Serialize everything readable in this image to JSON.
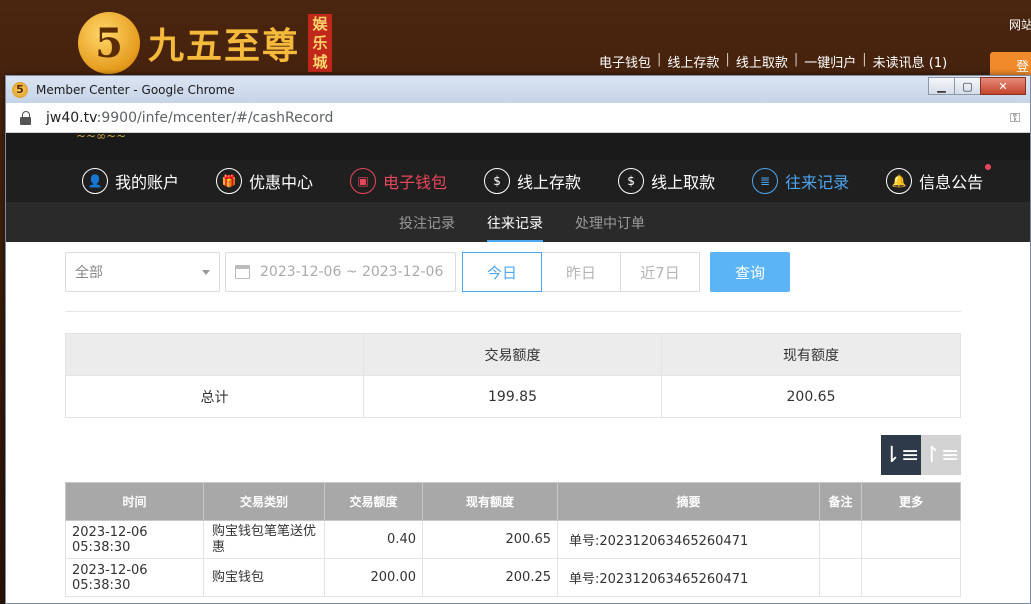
{
  "background_site": {
    "logo_number": "5",
    "logo_text": "九五至尊",
    "logo_tag": [
      "娱",
      "乐",
      "城"
    ],
    "top_links": [
      "电子钱包",
      "线上存款",
      "线上取款",
      "一键归户",
      "未读讯息 (1)"
    ],
    "corner_text": "网站",
    "corner_button": "登"
  },
  "window": {
    "title": "Member Center - Google Chrome",
    "controls": {
      "minimize": "▁",
      "maximize": "▢",
      "close": "✕"
    }
  },
  "address": {
    "host": "jw40.tv",
    "path": ":9900/infe/mcenter/#/cashRecord"
  },
  "nav": {
    "items": [
      {
        "label": "我的账户",
        "icon": "user-icon",
        "glyph": "👤"
      },
      {
        "label": "优惠中心",
        "icon": "gift-icon",
        "glyph": "🎁"
      },
      {
        "label": "电子钱包",
        "icon": "wallet-icon",
        "glyph": "▣"
      },
      {
        "label": "线上存款",
        "icon": "deposit-icon",
        "glyph": "$"
      },
      {
        "label": "线上取款",
        "icon": "withdraw-icon",
        "glyph": "$"
      },
      {
        "label": "往来记录",
        "icon": "record-icon",
        "glyph": "≣"
      },
      {
        "label": "信息公告",
        "icon": "bell-icon",
        "glyph": "🔔"
      }
    ],
    "colors": {
      "active_wallet": "#e8475b",
      "active_records": "#4da6f0"
    }
  },
  "subnav": {
    "items": [
      "投注记录",
      "往来记录",
      "处理中订单"
    ]
  },
  "filters": {
    "type_select": "全部",
    "date_range": "2023-12-06 ~ 2023-12-06",
    "range_buttons": [
      "今日",
      "昨日",
      "近7日"
    ],
    "query_button": "查询"
  },
  "summary": {
    "headers": [
      "",
      "交易额度",
      "现有额度"
    ],
    "row": {
      "label": "总计",
      "amount": "199.85",
      "balance": "200.65"
    }
  },
  "sort": {
    "desc_icon": "sort-desc-icon",
    "asc_icon": "sort-asc-icon"
  },
  "records": {
    "headers": [
      "时间",
      "交易类别",
      "交易额度",
      "现有额度",
      "摘要",
      "备注",
      "更多"
    ],
    "rows": [
      {
        "time": "2023-12-06 05:38:30",
        "type": "购宝钱包笔笔送优惠",
        "amount": "0.40",
        "balance": "200.65",
        "memo": "单号:202312063465260471",
        "remark": "",
        "more": ""
      },
      {
        "time": "2023-12-06 05:38:30",
        "type": "购宝钱包",
        "amount": "200.00",
        "balance": "200.25",
        "memo": "单号:202312063465260471",
        "remark": "",
        "more": ""
      }
    ]
  }
}
